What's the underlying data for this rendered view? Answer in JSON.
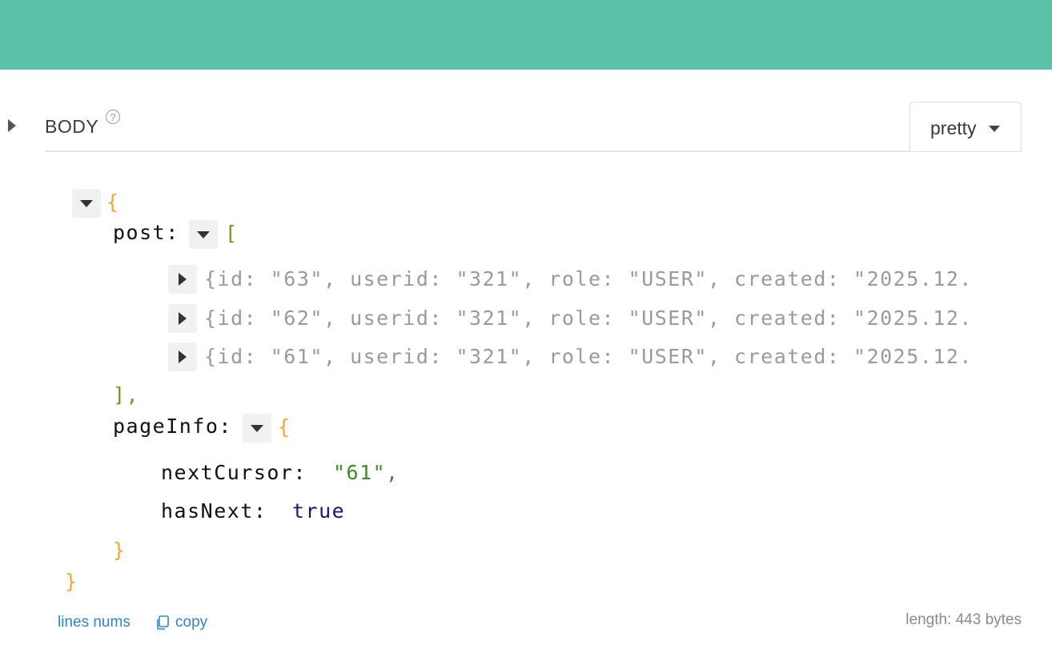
{
  "section": {
    "title": "BODY",
    "help_glyph": "?"
  },
  "format": {
    "selected": "pretty"
  },
  "json": {
    "open_brace": "{",
    "close_brace": "}",
    "post": {
      "key": "post:",
      "open": "[",
      "close": "],",
      "items": [
        {
          "text": "{id: \"63\", userid: \"321\", role: \"USER\", created: \"2025.12."
        },
        {
          "text": "{id: \"62\", userid: \"321\", role: \"USER\", created: \"2025.12."
        },
        {
          "text": "{id: \"61\", userid: \"321\", role: \"USER\", created: \"2025.12."
        }
      ]
    },
    "pageInfo": {
      "key": "pageInfo:",
      "open": "{",
      "close": "}",
      "nextCursor_key": "nextCursor:",
      "nextCursor_value": "\"61\"",
      "nextCursor_comma": ",",
      "hasNext_key": "hasNext:",
      "hasNext_value": "true"
    }
  },
  "footer": {
    "line_nums": "lines nums",
    "copy": "copy",
    "length": "length: 443 bytes"
  }
}
